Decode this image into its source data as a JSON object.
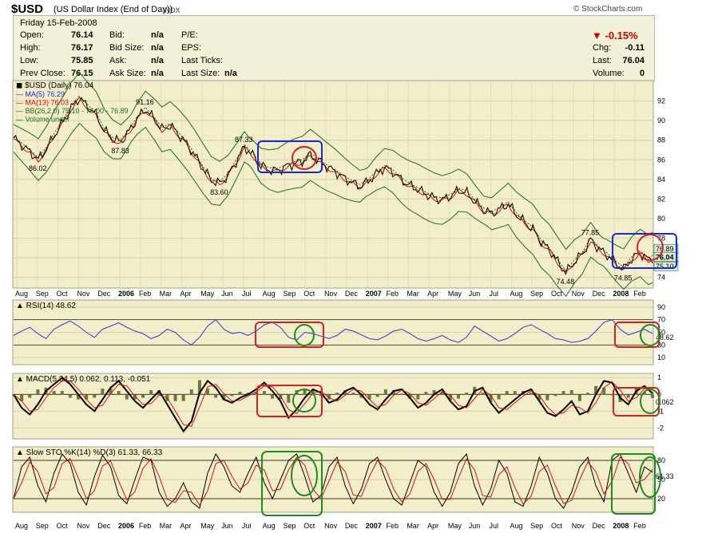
{
  "header": {
    "symbol": "$USD",
    "name": "(US Dollar Index (End of Day))",
    "exchange": "INDX",
    "credit": "© StockCharts.com"
  },
  "quote": {
    "date": "Friday 15-Feb-2008",
    "rows": [
      {
        "label": "Open:",
        "value": "76.14"
      },
      {
        "label": "High:",
        "value": "76.17"
      },
      {
        "label": "Low:",
        "value": "75.85"
      },
      {
        "label": "Prev Close:",
        "value": "76.15"
      }
    ],
    "rows2": [
      {
        "label": "Bid:",
        "value": "n/a"
      },
      {
        "label": "Bid Size:",
        "value": "n/a"
      },
      {
        "label": "Ask:",
        "value": "n/a"
      },
      {
        "label": "Ask Size:",
        "value": "n/a"
      }
    ],
    "rows3": [
      {
        "label": "P/E:",
        "value": ""
      },
      {
        "label": "EPS:",
        "value": ""
      },
      {
        "label": "Last Ticks:",
        "value": ""
      },
      {
        "label": "Last Size:",
        "value": "n/a"
      }
    ],
    "change_pct": "-0.15%",
    "right": [
      {
        "label": "Chg:",
        "value": "-0.11"
      },
      {
        "label": "Last:",
        "value": "76.04"
      },
      {
        "label": "Volume:",
        "value": "0"
      }
    ]
  },
  "chart_data": [
    {
      "type": "line",
      "title": "$USD (Daily) 76.04",
      "legend": [
        "MA(5) 76.29",
        "MA(13) 76.03",
        "BB(26,2.0) 75.10 - 76.00 - 76.89",
        "Volume undef"
      ],
      "legend_placement": "top-left",
      "ylim": [
        73,
        94
      ],
      "yticks": [
        74,
        76,
        78,
        80,
        82,
        84,
        86,
        88,
        90,
        92
      ],
      "x_labels": [
        "Aug",
        "Sep",
        "Oct",
        "Nov",
        "Dec",
        "2006",
        "Feb",
        "Mar",
        "Apr",
        "May",
        "Jun",
        "Jul",
        "Aug",
        "Sep",
        "Oct",
        "Nov",
        "Dec",
        "2007",
        "Feb",
        "Mar",
        "Apr",
        "May",
        "Jun",
        "Jul",
        "Aug",
        "Sep",
        "Oct",
        "Nov",
        "Dec",
        "2008",
        "Feb"
      ],
      "annotations": [
        "86.02",
        "87.83",
        "91.16",
        "83.60",
        "87.33",
        "74.48",
        "77.85",
        "74.85"
      ],
      "price_path": [
        [
          0,
          88.2
        ],
        [
          2,
          87.5
        ],
        [
          4,
          86.8
        ],
        [
          6,
          86.02
        ],
        [
          8,
          87.1
        ],
        [
          10,
          88.6
        ],
        [
          12,
          89.9
        ],
        [
          14,
          91.3
        ],
        [
          16,
          92.3
        ],
        [
          18,
          91.4
        ],
        [
          20,
          90.6
        ],
        [
          22,
          89.0
        ],
        [
          24,
          88.1
        ],
        [
          26,
          87.83
        ],
        [
          28,
          88.9
        ],
        [
          30,
          90.2
        ],
        [
          32,
          91.16
        ],
        [
          34,
          90.2
        ],
        [
          36,
          89.1
        ],
        [
          38,
          89.5
        ],
        [
          40,
          88.6
        ],
        [
          42,
          87.6
        ],
        [
          44,
          86.4
        ],
        [
          46,
          85.1
        ],
        [
          48,
          83.9
        ],
        [
          50,
          83.6
        ],
        [
          52,
          84.4
        ],
        [
          54,
          85.8
        ],
        [
          56,
          87.33
        ],
        [
          58,
          86.5
        ],
        [
          60,
          85.4
        ],
        [
          62,
          85.0
        ],
        [
          64,
          84.9
        ],
        [
          66,
          85.3
        ],
        [
          68,
          85.6
        ],
        [
          70,
          85.8
        ],
        [
          72,
          86.5
        ],
        [
          74,
          85.9
        ],
        [
          76,
          85.3
        ],
        [
          78,
          84.8
        ],
        [
          80,
          84.2
        ],
        [
          82,
          83.7
        ],
        [
          84,
          83.3
        ],
        [
          86,
          83.8
        ],
        [
          88,
          84.6
        ],
        [
          90,
          85.2
        ],
        [
          92,
          84.8
        ],
        [
          94,
          84.0
        ],
        [
          96,
          83.4
        ],
        [
          98,
          83.0
        ],
        [
          100,
          82.5
        ],
        [
          102,
          82.1
        ],
        [
          104,
          81.9
        ],
        [
          106,
          82.3
        ],
        [
          108,
          82.9
        ],
        [
          110,
          82.6
        ],
        [
          112,
          81.7
        ],
        [
          114,
          80.9
        ],
        [
          116,
          80.5
        ],
        [
          118,
          81.0
        ],
        [
          120,
          81.5
        ],
        [
          122,
          80.4
        ],
        [
          124,
          79.6
        ],
        [
          126,
          78.9
        ],
        [
          128,
          77.6
        ],
        [
          130,
          76.8
        ],
        [
          132,
          75.6
        ],
        [
          134,
          74.48
        ],
        [
          136,
          75.6
        ],
        [
          138,
          76.4
        ],
        [
          140,
          77.85
        ],
        [
          142,
          76.9
        ],
        [
          144,
          76.3
        ],
        [
          146,
          75.5
        ],
        [
          148,
          74.85
        ],
        [
          150,
          75.9
        ],
        [
          152,
          76.5
        ],
        [
          154,
          75.8
        ],
        [
          155,
          76.04
        ]
      ],
      "last_values": [
        "76.89",
        "76.04",
        "75.10"
      ]
    },
    {
      "type": "line",
      "title": "RSI(14) 48.62",
      "yticks": [
        90,
        70,
        50,
        30,
        10
      ],
      "ylim": [
        0,
        100
      ],
      "last_value": "48.62",
      "values": [
        45,
        52,
        58,
        48,
        40,
        55,
        62,
        68,
        60,
        50,
        42,
        55,
        60,
        65,
        58,
        52,
        48,
        40,
        45,
        55,
        50,
        38,
        30,
        42,
        60,
        70,
        55,
        48,
        50,
        45,
        52,
        62,
        66,
        58,
        42,
        38,
        50,
        48,
        44,
        40,
        45,
        55,
        52,
        46,
        40,
        38,
        44,
        52,
        55,
        48,
        40,
        36,
        40,
        45,
        38,
        34,
        42,
        60,
        52,
        44,
        36,
        40,
        48,
        58,
        62,
        55,
        48,
        40,
        38,
        34,
        36,
        40,
        52,
        66,
        70,
        55,
        46,
        50,
        55,
        48
      ]
    },
    {
      "type": "line",
      "title": "MACD(5,34,5) 0.062, 0.113, -0.051",
      "yticks": [
        1,
        0,
        -1,
        -2
      ],
      "ylim": [
        -2.6,
        1.2
      ],
      "last_value": "0.062",
      "values": [
        0.0,
        -0.8,
        -1.2,
        -0.6,
        0.2,
        0.6,
        1.0,
        0.6,
        0.0,
        -0.6,
        -1.0,
        -0.3,
        0.4,
        0.8,
        0.2,
        -0.4,
        -0.8,
        -0.3,
        0.2,
        -0.6,
        -1.4,
        -2.2,
        -1.6,
        0.1,
        0.8,
        0.4,
        -0.3,
        -0.5,
        -0.2,
        0.0,
        0.3,
        0.7,
        0.2,
        -0.4,
        -1.4,
        -0.9,
        -0.2,
        0.3,
        0.1,
        -0.5,
        -0.3,
        0.2,
        0.4,
        0.0,
        -0.6,
        -0.9,
        -0.3,
        0.2,
        0.3,
        -0.2,
        -0.8,
        -0.5,
        0.0,
        0.3,
        -0.4,
        -0.9,
        -0.7,
        0.2,
        0.4,
        -0.5,
        -1.1,
        -0.7,
        -0.3,
        0.1,
        0.3,
        -0.4,
        -1.1,
        -1.3,
        -0.9,
        -0.4,
        -1.2,
        -1.0,
        0.0,
        0.8,
        0.7,
        -0.2,
        -0.6,
        0.2,
        0.5,
        0.06
      ]
    },
    {
      "type": "line",
      "title": "Slow STO %K(14) %D(3) 61.33, 66.33",
      "yticks": [
        80,
        50,
        20
      ],
      "ylim": [
        0,
        100
      ],
      "last_values": [
        "61.33",
        "66.33"
      ],
      "values": [
        20,
        70,
        85,
        40,
        15,
        60,
        90,
        75,
        30,
        10,
        55,
        88,
        70,
        25,
        12,
        50,
        85,
        80,
        30,
        8,
        20,
        45,
        15,
        5,
        60,
        90,
        70,
        40,
        30,
        60,
        85,
        45,
        20,
        50,
        80,
        90,
        55,
        15,
        25,
        70,
        85,
        40,
        12,
        35,
        75,
        85,
        50,
        20,
        10,
        45,
        80,
        70,
        30,
        8,
        30,
        75,
        90,
        40,
        10,
        35,
        80,
        60,
        15,
        8,
        40,
        85,
        60,
        20,
        5,
        30,
        70,
        85,
        40,
        15,
        80,
        90,
        60,
        30,
        70,
        61.33
      ]
    }
  ]
}
